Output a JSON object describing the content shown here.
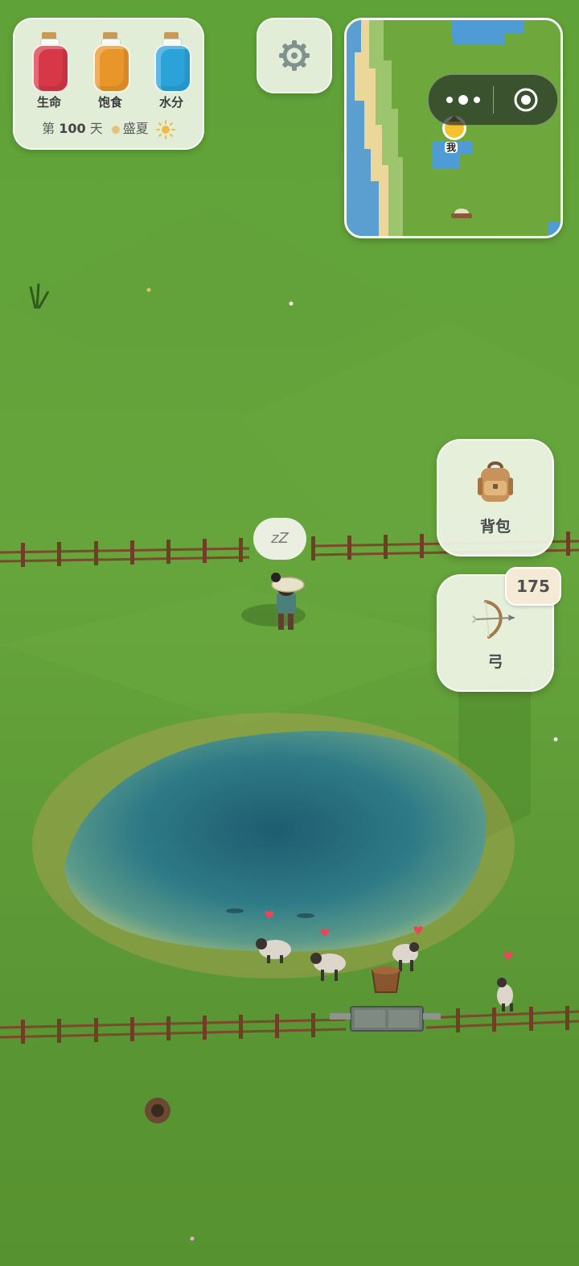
{
  "status": {
    "bars": [
      {
        "label": "生命",
        "color": "#d63847"
      },
      {
        "label": "饱食",
        "color": "#e8962a"
      },
      {
        "label": "水分",
        "color": "#2ba2d8"
      }
    ],
    "day_prefix": "第",
    "day_number": "100",
    "day_suffix": "天",
    "season": "盛夏"
  },
  "minimap": {
    "player_label": "我"
  },
  "buttons": {
    "backpack_label": "背包",
    "weapon_label": "弓",
    "weapon_count": "175"
  },
  "player": {
    "sleep_text": "zZ"
  },
  "colors": {
    "grass": "#5e9a36",
    "pond": "#2e7a86",
    "fence": "#7a4a2c",
    "panel": "#f0f5e8"
  }
}
